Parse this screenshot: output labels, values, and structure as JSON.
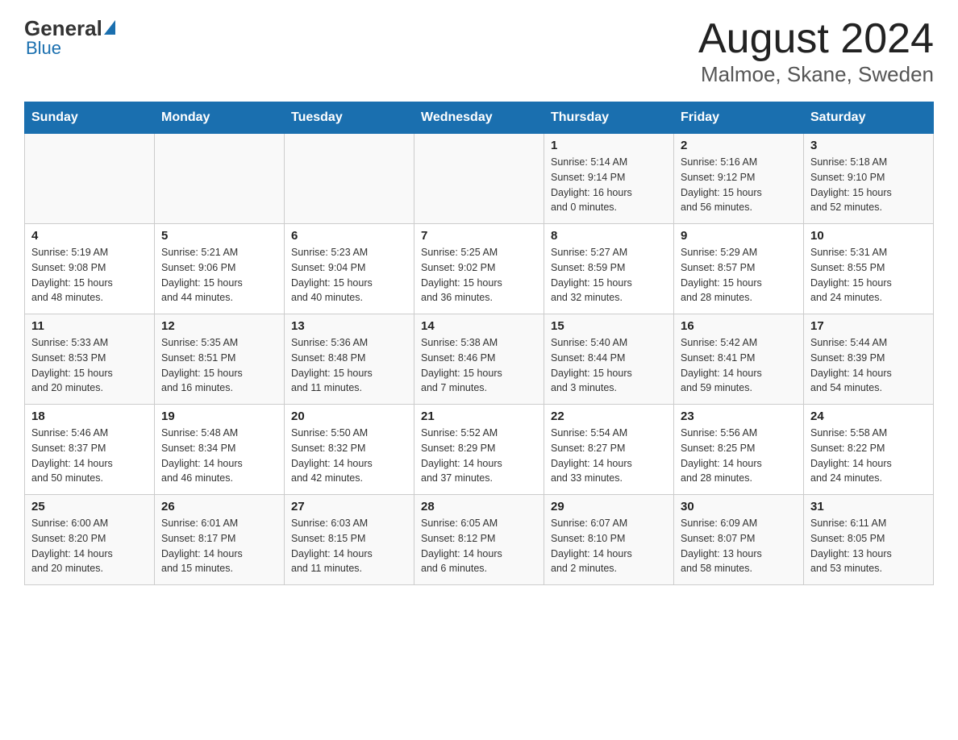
{
  "logo": {
    "general": "General",
    "blue": "Blue"
  },
  "title": "August 2024",
  "subtitle": "Malmoe, Skane, Sweden",
  "days_of_week": [
    "Sunday",
    "Monday",
    "Tuesday",
    "Wednesday",
    "Thursday",
    "Friday",
    "Saturday"
  ],
  "weeks": [
    [
      {
        "day": "",
        "info": ""
      },
      {
        "day": "",
        "info": ""
      },
      {
        "day": "",
        "info": ""
      },
      {
        "day": "",
        "info": ""
      },
      {
        "day": "1",
        "info": "Sunrise: 5:14 AM\nSunset: 9:14 PM\nDaylight: 16 hours\nand 0 minutes."
      },
      {
        "day": "2",
        "info": "Sunrise: 5:16 AM\nSunset: 9:12 PM\nDaylight: 15 hours\nand 56 minutes."
      },
      {
        "day": "3",
        "info": "Sunrise: 5:18 AM\nSunset: 9:10 PM\nDaylight: 15 hours\nand 52 minutes."
      }
    ],
    [
      {
        "day": "4",
        "info": "Sunrise: 5:19 AM\nSunset: 9:08 PM\nDaylight: 15 hours\nand 48 minutes."
      },
      {
        "day": "5",
        "info": "Sunrise: 5:21 AM\nSunset: 9:06 PM\nDaylight: 15 hours\nand 44 minutes."
      },
      {
        "day": "6",
        "info": "Sunrise: 5:23 AM\nSunset: 9:04 PM\nDaylight: 15 hours\nand 40 minutes."
      },
      {
        "day": "7",
        "info": "Sunrise: 5:25 AM\nSunset: 9:02 PM\nDaylight: 15 hours\nand 36 minutes."
      },
      {
        "day": "8",
        "info": "Sunrise: 5:27 AM\nSunset: 8:59 PM\nDaylight: 15 hours\nand 32 minutes."
      },
      {
        "day": "9",
        "info": "Sunrise: 5:29 AM\nSunset: 8:57 PM\nDaylight: 15 hours\nand 28 minutes."
      },
      {
        "day": "10",
        "info": "Sunrise: 5:31 AM\nSunset: 8:55 PM\nDaylight: 15 hours\nand 24 minutes."
      }
    ],
    [
      {
        "day": "11",
        "info": "Sunrise: 5:33 AM\nSunset: 8:53 PM\nDaylight: 15 hours\nand 20 minutes."
      },
      {
        "day": "12",
        "info": "Sunrise: 5:35 AM\nSunset: 8:51 PM\nDaylight: 15 hours\nand 16 minutes."
      },
      {
        "day": "13",
        "info": "Sunrise: 5:36 AM\nSunset: 8:48 PM\nDaylight: 15 hours\nand 11 minutes."
      },
      {
        "day": "14",
        "info": "Sunrise: 5:38 AM\nSunset: 8:46 PM\nDaylight: 15 hours\nand 7 minutes."
      },
      {
        "day": "15",
        "info": "Sunrise: 5:40 AM\nSunset: 8:44 PM\nDaylight: 15 hours\nand 3 minutes."
      },
      {
        "day": "16",
        "info": "Sunrise: 5:42 AM\nSunset: 8:41 PM\nDaylight: 14 hours\nand 59 minutes."
      },
      {
        "day": "17",
        "info": "Sunrise: 5:44 AM\nSunset: 8:39 PM\nDaylight: 14 hours\nand 54 minutes."
      }
    ],
    [
      {
        "day": "18",
        "info": "Sunrise: 5:46 AM\nSunset: 8:37 PM\nDaylight: 14 hours\nand 50 minutes."
      },
      {
        "day": "19",
        "info": "Sunrise: 5:48 AM\nSunset: 8:34 PM\nDaylight: 14 hours\nand 46 minutes."
      },
      {
        "day": "20",
        "info": "Sunrise: 5:50 AM\nSunset: 8:32 PM\nDaylight: 14 hours\nand 42 minutes."
      },
      {
        "day": "21",
        "info": "Sunrise: 5:52 AM\nSunset: 8:29 PM\nDaylight: 14 hours\nand 37 minutes."
      },
      {
        "day": "22",
        "info": "Sunrise: 5:54 AM\nSunset: 8:27 PM\nDaylight: 14 hours\nand 33 minutes."
      },
      {
        "day": "23",
        "info": "Sunrise: 5:56 AM\nSunset: 8:25 PM\nDaylight: 14 hours\nand 28 minutes."
      },
      {
        "day": "24",
        "info": "Sunrise: 5:58 AM\nSunset: 8:22 PM\nDaylight: 14 hours\nand 24 minutes."
      }
    ],
    [
      {
        "day": "25",
        "info": "Sunrise: 6:00 AM\nSunset: 8:20 PM\nDaylight: 14 hours\nand 20 minutes."
      },
      {
        "day": "26",
        "info": "Sunrise: 6:01 AM\nSunset: 8:17 PM\nDaylight: 14 hours\nand 15 minutes."
      },
      {
        "day": "27",
        "info": "Sunrise: 6:03 AM\nSunset: 8:15 PM\nDaylight: 14 hours\nand 11 minutes."
      },
      {
        "day": "28",
        "info": "Sunrise: 6:05 AM\nSunset: 8:12 PM\nDaylight: 14 hours\nand 6 minutes."
      },
      {
        "day": "29",
        "info": "Sunrise: 6:07 AM\nSunset: 8:10 PM\nDaylight: 14 hours\nand 2 minutes."
      },
      {
        "day": "30",
        "info": "Sunrise: 6:09 AM\nSunset: 8:07 PM\nDaylight: 13 hours\nand 58 minutes."
      },
      {
        "day": "31",
        "info": "Sunrise: 6:11 AM\nSunset: 8:05 PM\nDaylight: 13 hours\nand 53 minutes."
      }
    ]
  ]
}
